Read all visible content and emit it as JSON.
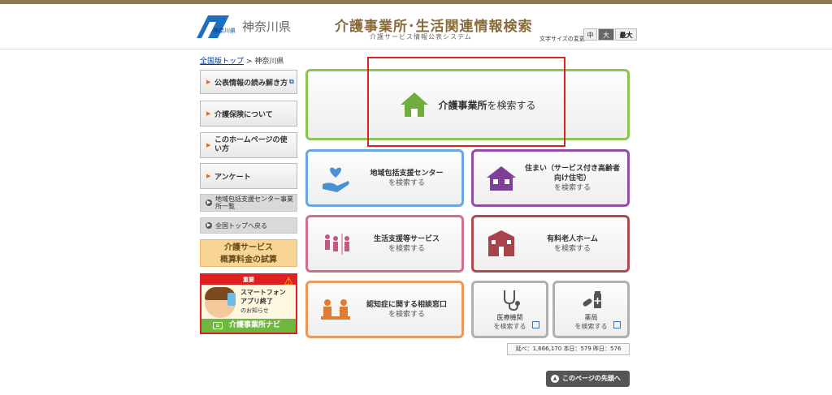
{
  "header": {
    "logo_text": "神奈川県",
    "pref_name": "神奈川県",
    "site_title": "介護事業所･生活関連情報検索",
    "site_subtitle": "介護サービス情報公表システム",
    "fontsize_label": "文字サイズの変更",
    "fontsize_small": "中",
    "fontsize_mid": "大",
    "fontsize_big": "最大"
  },
  "breadcrumb": {
    "top": "全国版トップ",
    "sep": ">",
    "current": "神奈川県"
  },
  "sidebar": {
    "items": [
      {
        "label": "公表情報の読み解き方",
        "ext": "⧉"
      },
      {
        "label": "介護保険について"
      },
      {
        "label": "このホームページの使い方"
      },
      {
        "label": "アンケート"
      }
    ],
    "gray_items": [
      {
        "label": "地域包括支援センター事業所一覧"
      },
      {
        "label": "全国トップへ戻る"
      }
    ],
    "fee_box": {
      "line1": "介護サービス",
      "line2": "概算料金の試算"
    },
    "navi_banner": {
      "badge": "重要",
      "msg_line1": "スマートフォン",
      "msg_line2": "アプリ終了",
      "msg_line3": "のお知らせ",
      "bar": "介護事業所ナビ"
    }
  },
  "tiles": {
    "main": {
      "strong": "介護事業所",
      "rest": "を検索する"
    },
    "houkatsu": {
      "title": "地域包括支援センター",
      "sub": "を検索する"
    },
    "sumai": {
      "title": "住まい（サービス付き高齢者向け住宅）",
      "sub": "を検索する"
    },
    "seikatsu": {
      "title": "生活支援等サービス",
      "sub": "を検索する"
    },
    "yuryo": {
      "title": "有料老人ホーム",
      "sub": "を検索する"
    },
    "ninchi": {
      "title": "認知症に関する相談窓口",
      "sub": "を検索する"
    },
    "iryo": {
      "title": "医療機関",
      "sub": "を検索する"
    },
    "yakkyoku": {
      "title": "薬局",
      "sub": "を検索する"
    }
  },
  "counter": {
    "total_label": "延べ：",
    "total": "1,666,170",
    "today_label": "本日：",
    "today": "579",
    "yesterday_label": "昨日：",
    "yesterday": "576"
  },
  "totop": {
    "label": "このページの先頭へ"
  },
  "colors": {
    "accent_gold": "#8a6a3a",
    "green": "#8ac654",
    "blue": "#6aa7de",
    "purple": "#8f4fa4",
    "pink": "#cf6f93",
    "maroon": "#b04a52",
    "orange": "#e89a5c",
    "highlight_red": "#e02020"
  }
}
